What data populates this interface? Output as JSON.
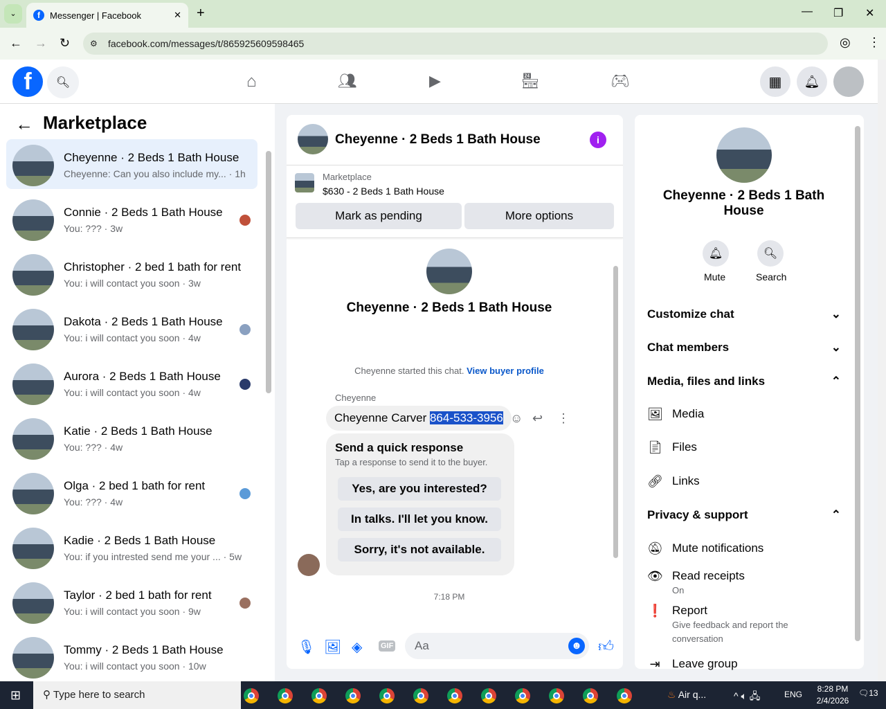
{
  "browser": {
    "tab_title": "Messenger | Facebook",
    "url": "facebook.com/messages/t/865925609598465"
  },
  "left": {
    "title": "Marketplace",
    "conversations": [
      {
        "name": "Cheyenne · 2 Beds 1 Bath House",
        "preview": "Cheyenne: Can you also include my... · 1h",
        "selected": true
      },
      {
        "name": "Connie · 2 Beds 1 Bath House",
        "preview": "You: ??? · 3w"
      },
      {
        "name": "Christopher · 2 bed 1 bath for rent",
        "preview": "You: i will contact you soon · 3w"
      },
      {
        "name": "Dakota · 2 Beds 1 Bath House",
        "preview": "You: i will contact you soon · 4w"
      },
      {
        "name": "Aurora · 2 Beds 1 Bath House",
        "preview": "You: i will contact you soon · 4w"
      },
      {
        "name": "Katie · 2 Beds 1 Bath House",
        "preview": "You: ??? · 4w"
      },
      {
        "name": "Olga · 2 bed 1 bath for rent",
        "preview": "You: ??? · 4w"
      },
      {
        "name": "Kadie · 2 Beds 1 Bath House",
        "preview": "You: if you intrested send me your ... · 5w"
      },
      {
        "name": "Taylor · 2 bed 1 bath for rent",
        "preview": "You: i will contact you soon · 9w"
      },
      {
        "name": "Tommy · 2 Beds 1 Bath House",
        "preview": "You: i will contact you soon · 10w"
      }
    ]
  },
  "chat": {
    "title": "Cheyenne · 2 Beds 1 Bath House",
    "listing_source": "Marketplace",
    "listing": "$630 - 2 Beds 1 Bath House",
    "mark_pending": "Mark as pending",
    "more_options": "More options",
    "intro_name": "Cheyenne · 2 Beds 1 Bath House",
    "started": "Cheyenne started this chat.",
    "view_profile": "View buyer profile",
    "sender": "Cheyenne",
    "message_text": "Cheyenne Carver ",
    "message_phone": "864-533-3956",
    "quick_title": "Send a quick response",
    "quick_sub": "Tap a response to send it to the buyer.",
    "quick_replies": [
      "Yes, are you interested?",
      "In talks. I'll let you know.",
      "Sorry, it's not available."
    ],
    "time": "7:18 PM",
    "input_placeholder": "Aa",
    "accent": "#0866ff"
  },
  "info": {
    "name": "Cheyenne · 2 Beds 1 Bath House",
    "mute": "Mute",
    "search": "Search",
    "customize": "Customize chat",
    "members": "Chat members",
    "media_section": "Media, files and links",
    "media": "Media",
    "files": "Files",
    "links": "Links",
    "privacy": "Privacy & support",
    "mute_notifications": "Mute notifications",
    "read_receipts": "Read receipts",
    "read_receipts_value": "On",
    "report": "Report",
    "report_sub": "Give feedback and report the conversation",
    "leave": "Leave group"
  },
  "taskbar": {
    "search": "Type here to search",
    "weather": "Air q...",
    "lang": "ENG",
    "time": "8:28 PM",
    "date": "2/4/2026",
    "notifications": "13"
  }
}
